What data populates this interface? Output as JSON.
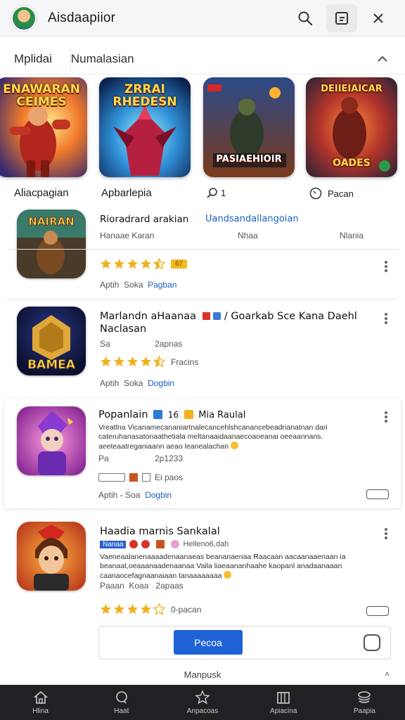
{
  "header": {
    "title": "Aisdaapiior",
    "icons": [
      "avatar",
      "search-icon",
      "window-icon",
      "close-icon"
    ]
  },
  "tabs": [
    {
      "label": "Mplidai"
    },
    {
      "label": "Numalasian"
    }
  ],
  "featured": [
    {
      "top_label": "ENAWARAN CEIMES",
      "bottom_label": ""
    },
    {
      "top_label": "ZRRAI RHEDESN",
      "bottom_label": ""
    },
    {
      "top_label": "",
      "bottom_label": "PASIAEHIOIR"
    },
    {
      "top_label": "DEIIEIAICAR",
      "bottom_label": "OADES"
    }
  ],
  "categories": [
    "Aliacpagian",
    "Apbarlepia",
    "1",
    "Pacan"
  ],
  "cards": [
    {
      "title": "Rioradrard arakian",
      "title_link": "Uandsandallangoian",
      "meta_a": "Hanaae Karan",
      "meta_b": "Nhaa",
      "meta_c": "Nlania",
      "rating_badge": "67",
      "footer_a": "Aptih",
      "footer_b": "Soka",
      "footer_link": "Pagban"
    },
    {
      "title": "Marlandn aHaanaa",
      "title_rest": "/ Goarkab Sce Kana Daehl",
      "title_line2": "Naclasan",
      "meta_a": "Sa",
      "meta_b": "2apnas",
      "rating_text": "Fracins",
      "footer_a": "Aptih",
      "footer_b": "Soka",
      "footer_link": "Dogbin"
    },
    {
      "title": "Popanlain",
      "title_badge": "16",
      "title_rest": "Mia Raulal",
      "desc_line1": "Vreatlna Vicanamecananiartnalecancehlshcanancebeadrianatnan dari",
      "desc_line2": "cateruhanasatonaathetiala meltanaaidaanaecoaoeanai oeeaannans.",
      "desc_line3": "aeeteaatreganiaann aeao leanealachan",
      "meta_a": "Pa",
      "meta_b": "2p1233",
      "meta_c": "Ei paos",
      "footer_a": "Aptih",
      "footer_b": "Soa",
      "footer_link": "Dogbin"
    },
    {
      "title": "Haadia marnis Sankalal",
      "tag_label": "Nanaa",
      "tag_rest": "Helleno6,dah",
      "desc_line1": "Vaeneaalanenaaaadenaanaeas beananaenaa Raacaan aacaanaaenaan ia",
      "desc_line2": "beanaat,oeaaanaadenaanaa Vaila liaeaananhaahe kaopanl anadaanaaan",
      "desc_line3": "caanaocefagnaanaiaan tanaaaaaaaa",
      "meta_a": "Paaan",
      "meta_b": "Koaa",
      "meta_c": "2apaas",
      "rating_text": "0-pacan",
      "button_label": "Pecoa"
    }
  ],
  "footer_note": "Manpusk",
  "bottom_nav": [
    {
      "label": "Hlina"
    },
    {
      "label": "Haat"
    },
    {
      "label": "Anpacoas"
    },
    {
      "label": "Apiacina"
    },
    {
      "label": "Paapia"
    }
  ],
  "colors": {
    "accent": "#1f62d6",
    "star": "#f2b01e",
    "nav_bg": "#1f2124"
  }
}
